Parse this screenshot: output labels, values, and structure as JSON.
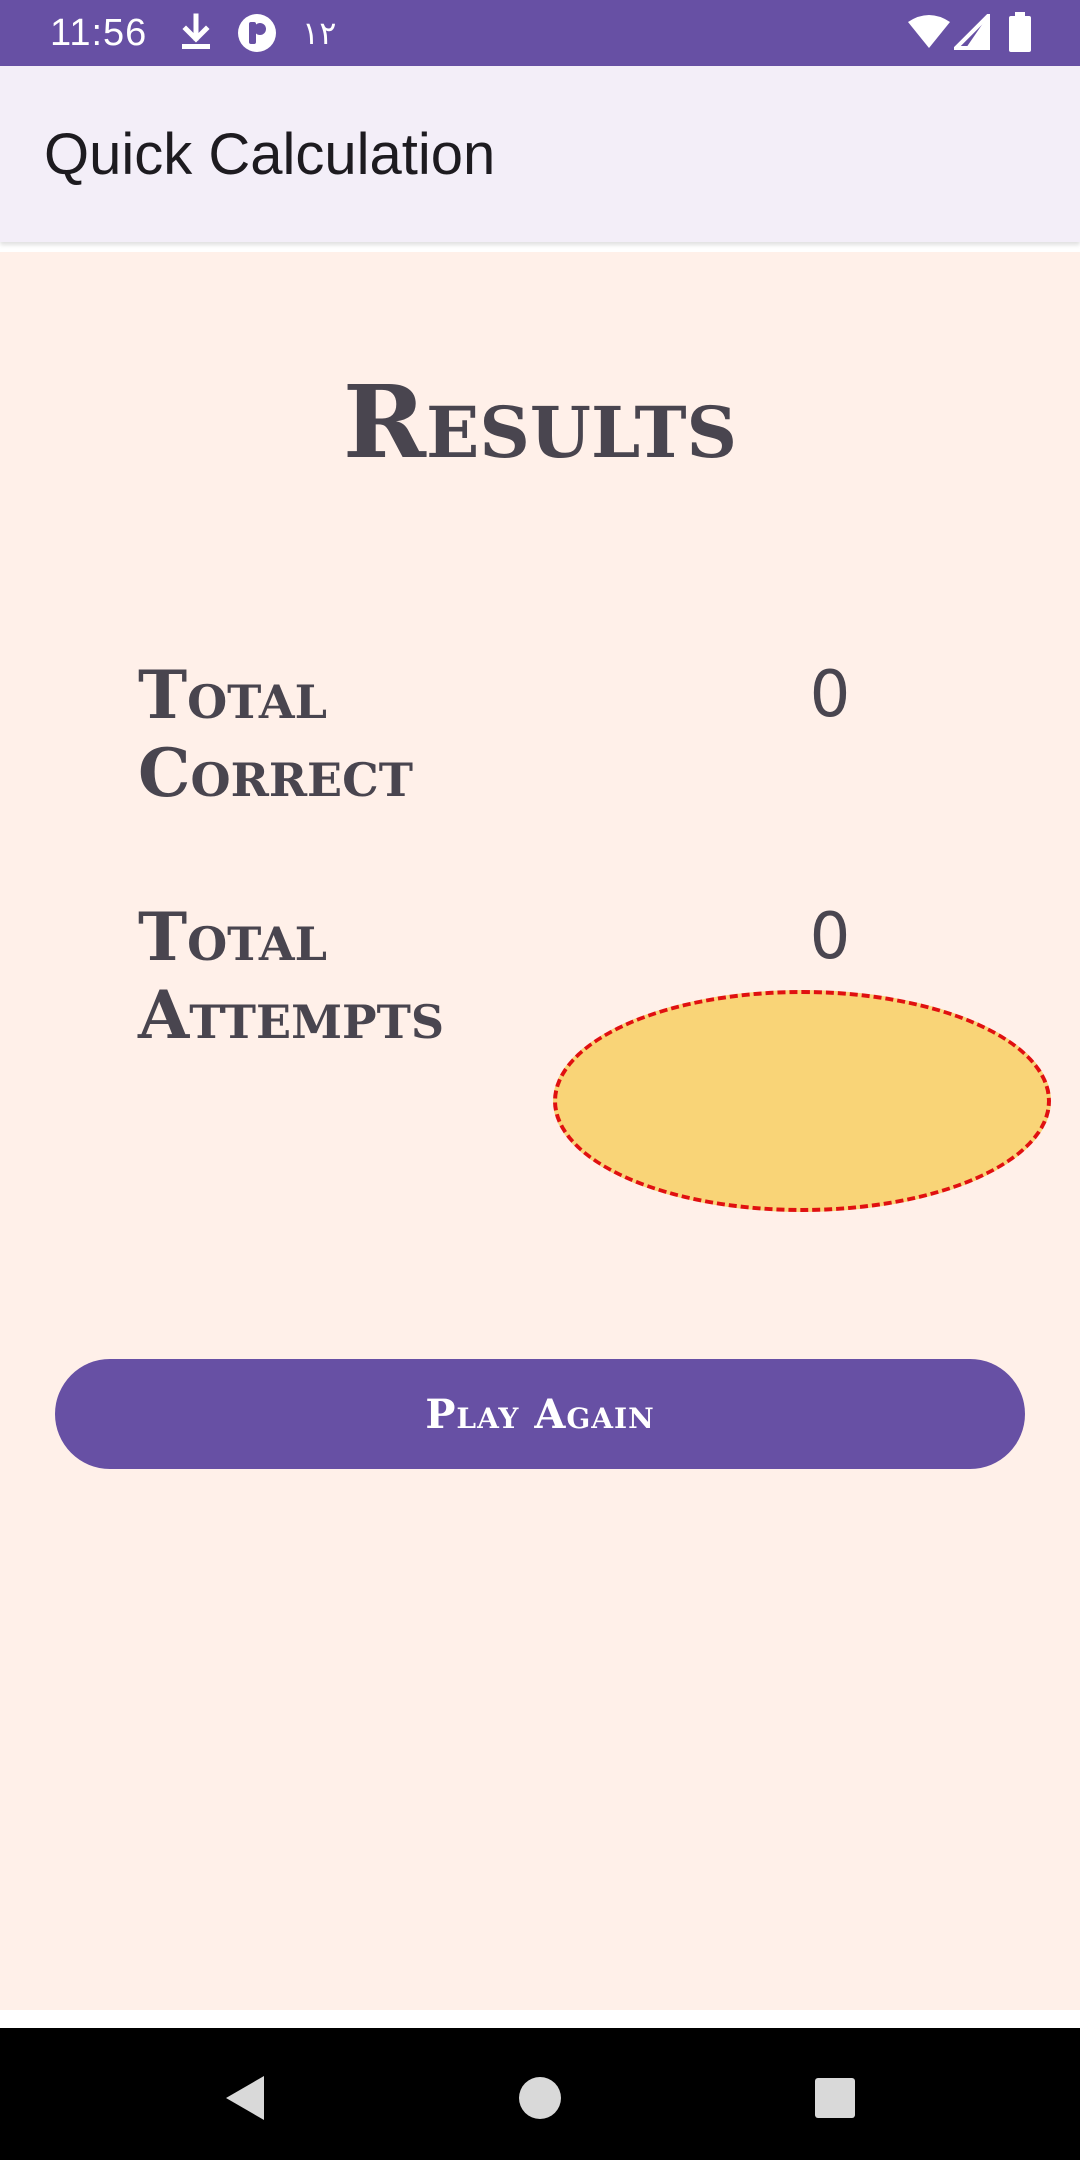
{
  "status_bar": {
    "time": "11:56",
    "extra_text": "١٢",
    "icons": [
      "download-icon",
      "app-notification-icon",
      "wifi-icon",
      "signal-icon",
      "battery-icon"
    ],
    "background": "#6750a4"
  },
  "app_bar": {
    "title": "Quick Calculation"
  },
  "results": {
    "heading": "Results",
    "stats": [
      {
        "label": "Total Correct",
        "value": "0"
      },
      {
        "label": "Total Attempts",
        "value": "0"
      }
    ]
  },
  "actions": {
    "play_again_label": "Play Again"
  },
  "nav_bar": {
    "icons": [
      "back-icon",
      "home-icon",
      "recents-icon"
    ]
  },
  "colors": {
    "primary": "#6750a4",
    "content_background": "#fff0e9",
    "text": "#49454f",
    "highlight_fill": "#f9d477",
    "highlight_border": "#e01010"
  }
}
